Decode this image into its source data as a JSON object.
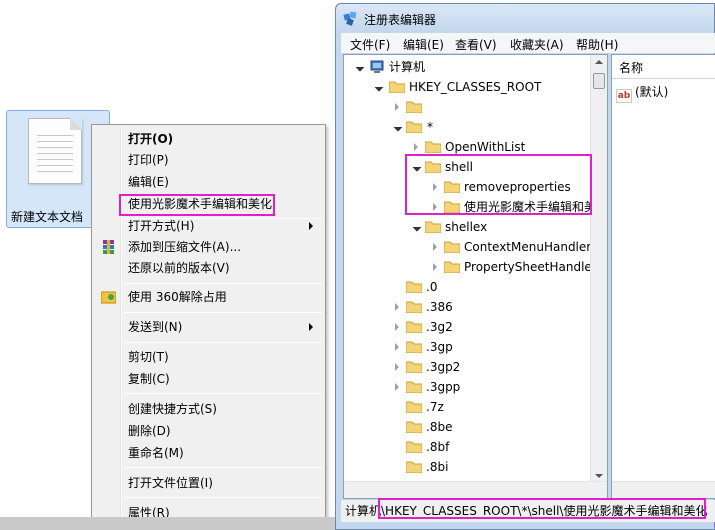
{
  "desktop": {
    "file_label": "新建文本文档"
  },
  "context_menu": {
    "items": [
      {
        "label": "打开(O)",
        "bold": true
      },
      {
        "label": "打印(P)"
      },
      {
        "label": "编辑(E)"
      },
      {
        "label": "使用光影魔术手编辑和美化"
      },
      {
        "label": "打开方式(H)",
        "submenu": true
      },
      {
        "label": "添加到压缩文件(A)...",
        "icon": "winrar-icon"
      },
      {
        "label": "还原以前的版本(V)"
      },
      {
        "label": "使用 360解除占用",
        "icon": "360-unlock-icon"
      },
      {
        "label": "发送到(N)",
        "submenu": true
      },
      {
        "label": "剪切(T)"
      },
      {
        "label": "复制(C)"
      },
      {
        "label": "创建快捷方式(S)"
      },
      {
        "label": "删除(D)"
      },
      {
        "label": "重命名(M)"
      },
      {
        "label": "打开文件位置(I)"
      },
      {
        "label": "属性(R)"
      }
    ]
  },
  "regedit": {
    "title": "注册表编辑器",
    "menu": [
      "文件(F)",
      "编辑(E)",
      "查看(V)",
      "收藏夹(A)",
      "帮助(H)"
    ],
    "tree": [
      {
        "label": "计算机",
        "icon": "computer-icon"
      },
      {
        "label": "HKEY_CLASSES_ROOT"
      },
      {
        "label": ""
      },
      {
        "label": "*"
      },
      {
        "label": "OpenWithList"
      },
      {
        "label": "shell"
      },
      {
        "label": "removeproperties"
      },
      {
        "label": "使用光影魔术手编辑和美化"
      },
      {
        "label": "shellex"
      },
      {
        "label": "ContextMenuHandlers"
      },
      {
        "label": "PropertySheetHandlers"
      },
      {
        "label": ".0"
      },
      {
        "label": ".386"
      },
      {
        "label": ".3g2"
      },
      {
        "label": ".3gp"
      },
      {
        "label": ".3gp2"
      },
      {
        "label": ".3gpp"
      },
      {
        "label": ".7z"
      },
      {
        "label": ".8be"
      },
      {
        "label": ".8bf"
      },
      {
        "label": ".8bi"
      }
    ],
    "list_header": "名称",
    "list_rows": [
      {
        "name": "(默认)",
        "icon_text": "ab"
      }
    ],
    "status_prefix": "计算机",
    "status_path": "\\HKEY_CLASSES_ROOT\\*\\shell\\使用光影魔术手编辑和美化"
  },
  "colors": {
    "highlight": "#e020c8",
    "folder": "#f4d476",
    "title_bg": "#c3d6ec"
  }
}
